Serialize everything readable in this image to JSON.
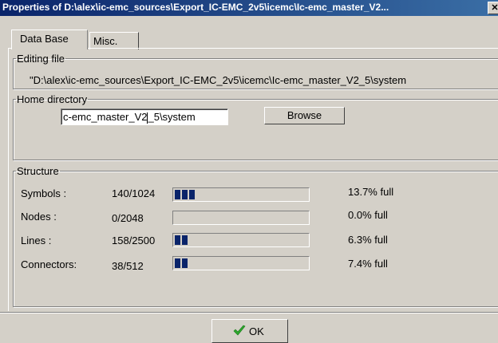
{
  "window": {
    "title": "Properties of D:\\alex\\ic-emc_sources\\Export_IC-EMC_2v5\\icemc\\Ic-emc_master_V2..."
  },
  "tabs": [
    {
      "label": "Data Base",
      "active": true
    },
    {
      "label": "Misc.",
      "active": false
    }
  ],
  "editing_file": {
    "legend": "Editing file",
    "path": "\"D:\\alex\\ic-emc_sources\\Export_IC-EMC_2v5\\icemc\\Ic-emc_master_V2_5\\system"
  },
  "home_directory": {
    "legend": "Home directory",
    "value_before_caret": "c-emc_master_V2",
    "value_after_caret": "_5\\system",
    "browse_label": "Browse"
  },
  "structure": {
    "legend": "Structure",
    "rows": [
      {
        "label": "Symbols :",
        "count": "140/1024",
        "pct_text": "13.7% full",
        "fraction": 0.137
      },
      {
        "label": "Nodes :",
        "count": "0/2048",
        "pct_text": "0.0% full",
        "fraction": 0.0
      },
      {
        "label": "Lines :",
        "count": "158/2500",
        "pct_text": "6.3% full",
        "fraction": 0.063
      },
      {
        "label": "Connectors:",
        "count": "38/512",
        "pct_text": "7.4% full",
        "fraction": 0.074
      }
    ]
  },
  "footer": {
    "ok_label": "OK"
  },
  "colors": {
    "progress": "#0a246a",
    "titlebar": "#0a246a",
    "ok_check": "#2ea82e"
  }
}
